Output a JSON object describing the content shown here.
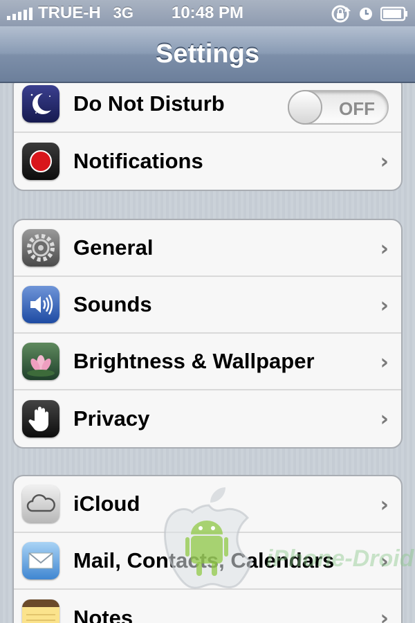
{
  "status_bar": {
    "carrier": "TRUE-H",
    "network": "3G",
    "time": "10:48 PM",
    "icons": [
      "signal-icon",
      "rotation-lock-icon",
      "alarm-icon",
      "battery-icon"
    ]
  },
  "nav": {
    "title": "Settings"
  },
  "groups": [
    {
      "items": [
        {
          "label": "Do Not Disturb",
          "icon": "moon-icon",
          "toggle": "OFF"
        },
        {
          "label": "Notifications",
          "icon": "notifications-icon"
        }
      ]
    },
    {
      "items": [
        {
          "label": "General",
          "icon": "gear-icon"
        },
        {
          "label": "Sounds",
          "icon": "speaker-icon"
        },
        {
          "label": "Brightness & Wallpaper",
          "icon": "lotus-icon"
        },
        {
          "label": "Privacy",
          "icon": "hand-icon"
        }
      ]
    },
    {
      "items": [
        {
          "label": "iCloud",
          "icon": "cloud-icon"
        },
        {
          "label": "Mail, Contacts, Calendars",
          "icon": "mail-icon"
        },
        {
          "label": "Notes",
          "icon": "notes-icon"
        }
      ]
    }
  ],
  "watermark": {
    "text": "iPhone-Droid"
  },
  "colors": {
    "nav_bar": "#7d8fa9",
    "row_background": "#f7f7f7",
    "page_background": "#c5ccd4"
  }
}
